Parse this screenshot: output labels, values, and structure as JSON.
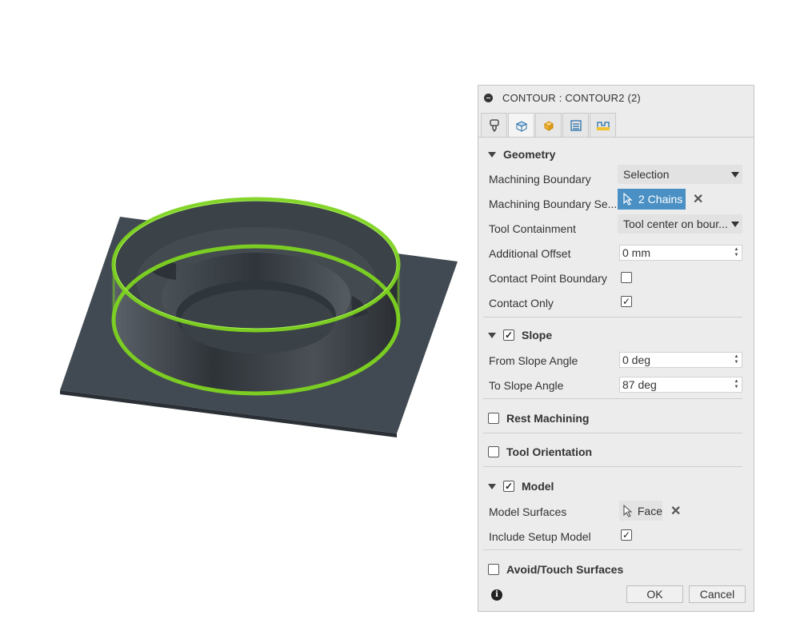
{
  "dialog": {
    "title": "CONTOUR : CONTOUR2 (2)",
    "tabs": [
      "tool-icon",
      "geometry-icon",
      "heights-icon",
      "passes-icon",
      "linking-icon"
    ]
  },
  "geometry": {
    "header": "Geometry",
    "machining_boundary_label": "Machining Boundary",
    "machining_boundary_value": "Selection",
    "boundary_selection_label": "Machining Boundary Se...",
    "boundary_selection_value": "2 Chains",
    "tool_containment_label": "Tool Containment",
    "tool_containment_value": "Tool center on bour...",
    "additional_offset_label": "Additional Offset",
    "additional_offset_value": "0 mm",
    "contact_point_boundary_label": "Contact Point Boundary",
    "contact_point_boundary_checked": false,
    "contact_only_label": "Contact Only",
    "contact_only_checked": true
  },
  "slope": {
    "header": "Slope",
    "enabled": true,
    "from_label": "From Slope Angle",
    "from_value": "0 deg",
    "to_label": "To Slope Angle",
    "to_value": "87 deg"
  },
  "rest_machining": {
    "header": "Rest Machining",
    "enabled": false
  },
  "tool_orientation": {
    "header": "Tool Orientation",
    "enabled": false
  },
  "model": {
    "header": "Model",
    "enabled": true,
    "surfaces_label": "Model Surfaces",
    "surfaces_value": "Face",
    "include_setup_label": "Include Setup Model",
    "include_setup_checked": true
  },
  "avoid_touch": {
    "header": "Avoid/Touch Surfaces",
    "enabled": false
  },
  "footer": {
    "ok_label": "OK",
    "cancel_label": "Cancel"
  },
  "colors": {
    "selection_highlight": "#7ed321",
    "part_dark": "#3d444b",
    "chip_blue": "#4a90c4"
  }
}
